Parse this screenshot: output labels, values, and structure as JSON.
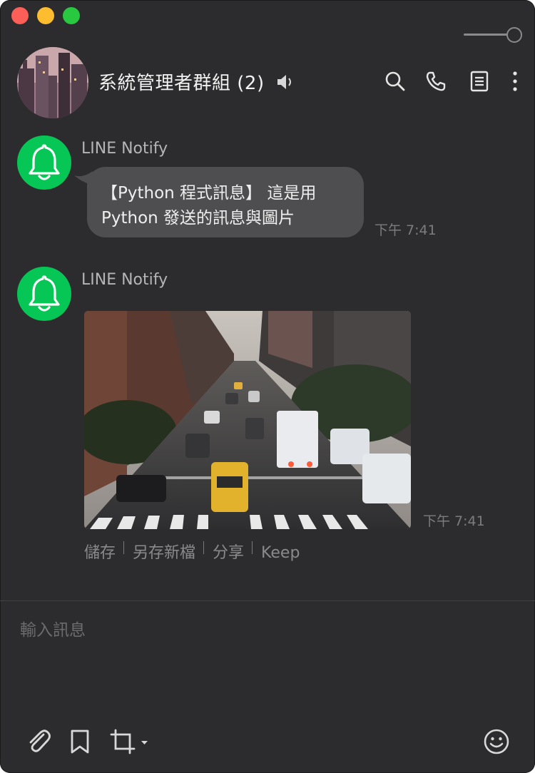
{
  "window": {
    "controls": [
      "close",
      "minimize",
      "zoom"
    ]
  },
  "header": {
    "title": "系統管理者群組 (2)",
    "icons": [
      "speaker-icon",
      "search-icon",
      "phone-icon",
      "notes-icon",
      "more-icon"
    ]
  },
  "messages": [
    {
      "sender": "LINE Notify",
      "avatar_icon": "bell-icon",
      "text_line1": "【Python 程式訊息】 這是用",
      "text_line2": "Python 發送的訊息與圖片",
      "time": "下午 7:41"
    },
    {
      "sender": "LINE Notify",
      "avatar_icon": "bell-icon",
      "image": "city-street-traffic-photo",
      "time": "下午 7:41",
      "actions": [
        "儲存",
        "另存新檔",
        "分享",
        "Keep"
      ]
    }
  ],
  "composer": {
    "placeholder": "輸入訊息",
    "icons": [
      "attach-icon",
      "bookmark-icon",
      "crop-icon",
      "emoji-icon"
    ]
  },
  "colors": {
    "background": "#2c2c2e",
    "bubble": "#4e4e51",
    "line_green": "#06c755"
  }
}
